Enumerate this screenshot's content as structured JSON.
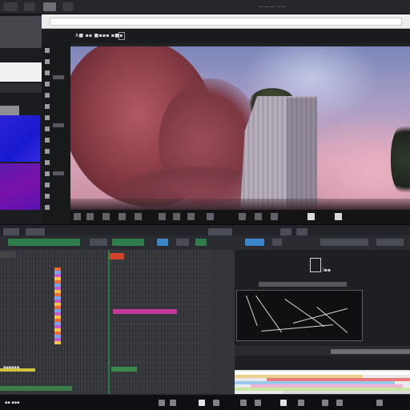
{
  "window": {
    "title": "",
    "top_title": "———·——"
  },
  "bookmarks": {
    "text": "A■ ▪▪ ■▪▪▪ ▪■▪"
  },
  "preview": {
    "label": "I▪▪"
  },
  "timeline": {
    "label_strip": "▪▪▪▪▪▪"
  },
  "taskbar": {
    "text": "▪▪ ▪▪▪"
  },
  "icons": {
    "close": "close-icon",
    "folder": "folder-icon",
    "play": "play-icon",
    "gear": "gear-icon"
  },
  "colors": {
    "accent_blue": "#3a86c8",
    "accent_green": "#2e7d4a",
    "accent_red": "#c6462e",
    "clip_pink": "#c2399c",
    "swatch_blue": "#2a24d8",
    "swatch_purple": "#6a16b0"
  }
}
